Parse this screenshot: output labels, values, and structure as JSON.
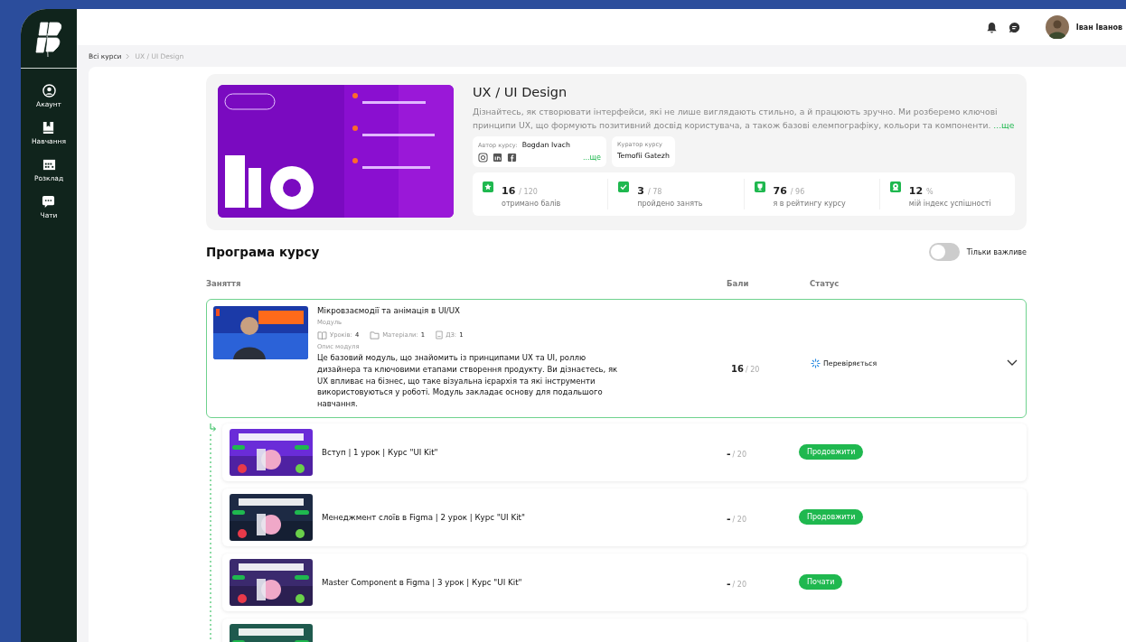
{
  "sidebar": {
    "items": [
      {
        "kind": "account",
        "label": "Акаунт"
      },
      {
        "kind": "book",
        "label": "Навчання"
      },
      {
        "kind": "calendar",
        "label": "Розклад"
      },
      {
        "kind": "chat",
        "label": "Чати"
      }
    ]
  },
  "topbar": {
    "user_name": "Іван Іванов"
  },
  "breadcrumb": [
    "Всі курси",
    "UX / UI Design"
  ],
  "course": {
    "title": "UX / UI Design",
    "description": "Дізнайтесь, як створювати інтерфейси, які не лише виглядають стильно, а й працюють зручно. Ми розберемо ключові принципи UX, що формують позитивний досвід користувача, а також базові елемпографіку, кольори та компоненти.",
    "description_more": "...ще",
    "author_label": "Автор курсу:",
    "author": "Bogdan Ivach",
    "author_more": "...ще",
    "curator_label": "Куратор курсу",
    "curator": "Temofii Gatezh",
    "stats": [
      {
        "kind": "star",
        "value": "16",
        "total": "/ 120",
        "label": "отримано балів"
      },
      {
        "kind": "check",
        "value": "3",
        "total": "/ 78",
        "label": "пройдено занять"
      },
      {
        "kind": "trophy",
        "value": "76",
        "total": "/ 96",
        "label": "я в рейтингу курсу"
      },
      {
        "kind": "medal",
        "value": "12",
        "total": "%",
        "label": "мій індекс успішності"
      }
    ]
  },
  "program": {
    "title": "Програма курсу",
    "toggle": {
      "label": "Тільки важливе",
      "on": false
    },
    "columns": [
      "Заняття",
      "Бали",
      "Статус"
    ],
    "module": {
      "title": "Мікровзаємодії та анімація в UI/UX",
      "type": "Модуль",
      "lessons_label": "Уроків:",
      "lessons": "4",
      "materials_label": "Матеріали:",
      "materials": "1",
      "hw_label": "ДЗ:",
      "hw": "1",
      "description_label": "Опис модуля",
      "description": "Це базовий модуль, що знайомить із принципами UX та UI, роллю дизайнера та ключовими етапами створення продукту. Ви дізнаєтесь, як UX впливає на бізнес, що таке візуальна ієрархія та які інструменти використовуються у роботі. Модуль закладає основу для подальшого навчання.",
      "score": "16",
      "total": "/ 20",
      "status": "Перевіряється",
      "expanded": true
    },
    "lessons": [
      {
        "title": "Вступ | 1 урок | Курс \"UI Kit\"",
        "score": "-",
        "total": "/ 20",
        "action": "Продовжити",
        "kind": "lesson"
      },
      {
        "title": "Менеджмент слоїв в Figma | 2 урок | Курс \"UI Kit\"",
        "score": "-",
        "total": "/ 20",
        "action": "Продовжити",
        "kind": "lesson"
      },
      {
        "title": "Master Component в Figma | 3 урок | Курс \"UI Kit\"",
        "score": "-",
        "total": "/ 20",
        "action": "Почати",
        "kind": "lesson"
      },
      {
        "kind": "picture"
      }
    ]
  }
}
